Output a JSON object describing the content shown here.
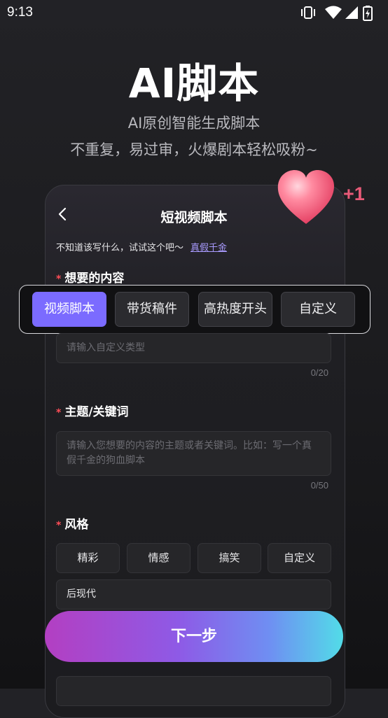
{
  "status_bar": {
    "time": "9:13"
  },
  "hero": {
    "title": "AI脚本",
    "subtitle_line1": "AI原创智能生成脚本",
    "subtitle_line2": "不重复，易过审，火爆剧本轻松吸粉~"
  },
  "badge": {
    "plus_one": "+1"
  },
  "card": {
    "title": "短视频脚本",
    "hint_text": "不知道该写什么，试试这个吧～",
    "hint_link": "真假千金"
  },
  "content_section": {
    "label": "想要的内容",
    "required_mark": "*",
    "tabs": [
      {
        "label": "视频脚本",
        "active": true
      },
      {
        "label": "带货稿件",
        "active": false
      },
      {
        "label": "高热度开头",
        "active": false
      },
      {
        "label": "自定义",
        "active": false
      }
    ],
    "custom_input_placeholder": "请输入自定义类型",
    "custom_counter": "0/20"
  },
  "topic_section": {
    "label": "主题/关键词",
    "required_mark": "*",
    "placeholder": "请输入您想要的内容的主题或者关键词。比如：写一个真假千金的狗血脚本",
    "counter": "0/50"
  },
  "style_section": {
    "label": "风格",
    "required_mark": "*",
    "chips": [
      "精彩",
      "情感",
      "搞笑",
      "自定义"
    ],
    "value": "后现代"
  },
  "next_button": {
    "label": "下一步"
  },
  "colors": {
    "accent": "#7b6bff",
    "required": "#ff4d57",
    "link": "#a99bff",
    "plus_one": "#e85a78"
  }
}
